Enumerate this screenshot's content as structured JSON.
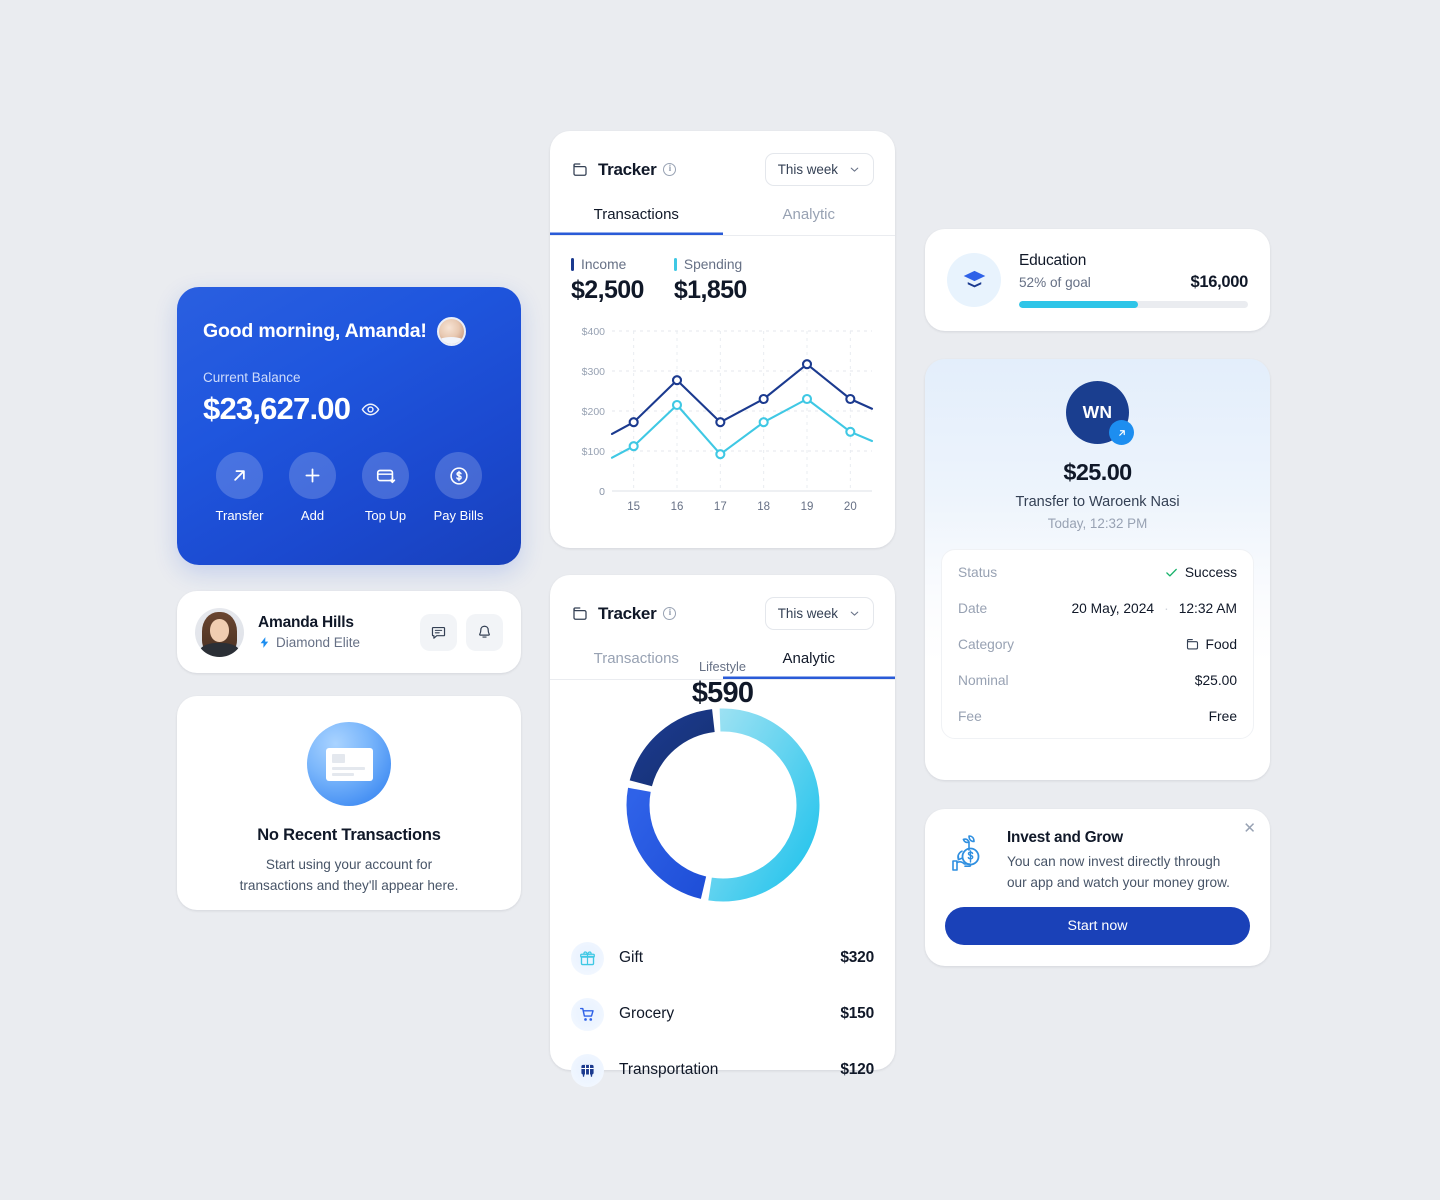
{
  "balance": {
    "greeting": "Good morning, Amanda!",
    "balance_label": "Current Balance",
    "balance_amount": "$23,627.00",
    "actions": [
      {
        "label": "Transfer",
        "icon": "arrow-up-right-icon"
      },
      {
        "label": "Add",
        "icon": "plus-icon"
      },
      {
        "label": "Top Up",
        "icon": "card-download-icon"
      },
      {
        "label": "Pay Bills",
        "icon": "dollar-circle-icon"
      }
    ],
    "accent": "#1a4fd6"
  },
  "profile": {
    "name": "Amanda Hills",
    "tier": "Diamond Elite",
    "tier_icon": "lightning-bolt-icon",
    "message_icon": "message-icon",
    "bell_icon": "bell-icon"
  },
  "empty_state": {
    "title": "No Recent Transactions",
    "line1": "Start using your account for",
    "line2": "transactions and they'll appear here."
  },
  "tracker_transactions": {
    "title": "Tracker",
    "range": "This week",
    "tabs": [
      {
        "label": "Transactions",
        "active": true
      },
      {
        "label": "Analytic",
        "active": false
      }
    ],
    "income_label": "Income",
    "income_value": "$2,500",
    "income_color": "#1b3a8f",
    "spending_label": "Spending",
    "spending_value": "$1,850",
    "spending_color": "#3fc8e4"
  },
  "tracker_analytic": {
    "title": "Tracker",
    "range": "This week",
    "tabs": [
      {
        "label": "Transactions",
        "active": false
      },
      {
        "label": "Analytic",
        "active": true
      }
    ],
    "center_label": "Lifestyle",
    "center_value": "$590",
    "legend": [
      {
        "name": "Gift",
        "amount": "$320",
        "icon": "gift-icon",
        "color": "#3fc8e4"
      },
      {
        "name": "Grocery",
        "amount": "$150",
        "icon": "shopping-cart-icon",
        "color": "#2f62e8"
      },
      {
        "name": "Transportation",
        "amount": "$120",
        "icon": "bus-icon",
        "color": "#1b3a8f"
      }
    ]
  },
  "chart_data": [
    {
      "type": "line",
      "title": "Tracker — Transactions",
      "x": [
        "15",
        "16",
        "17",
        "18",
        "19",
        "20"
      ],
      "xlabel": "",
      "ylabel": "",
      "ylim": [
        0,
        400
      ],
      "yticks": [
        "0",
        "$100",
        "$200",
        "$300",
        "$400"
      ],
      "grid": true,
      "legend": [
        "Income",
        "Spending"
      ],
      "series": [
        {
          "name": "Income",
          "color": "#1b3a8f",
          "values": [
            172,
            277,
            172,
            230,
            317,
            230
          ]
        },
        {
          "name": "Spending",
          "color": "#3fc8e4",
          "values": [
            112,
            215,
            92,
            172,
            230,
            148
          ]
        }
      ]
    },
    {
      "type": "pie",
      "title": "Lifestyle spending breakdown",
      "center_label": "Lifestyle",
      "center_value": 590,
      "categories": [
        "Gift",
        "Grocery",
        "Transportation"
      ],
      "values": [
        320,
        150,
        120
      ],
      "colors": [
        "#3fc8e4",
        "#2f62e8",
        "#1b3a8f"
      ],
      "legend": "below"
    }
  ],
  "goal": {
    "title": "Education",
    "subtitle": "52% of goal",
    "amount": "$16,000",
    "progress_percent": 52,
    "progress_color": "#2ec5e8",
    "icon": "graduation-cap-icon"
  },
  "transfer": {
    "initials": "WN",
    "amount": "$25.00",
    "description": "Transfer to Waroenk Nasi",
    "when": "Today, 12:32 PM",
    "badge_icon": "arrow-up-right-icon",
    "details": [
      {
        "key": "Status",
        "value": "Success",
        "icon": "check-icon",
        "icon_color": "#18b26b"
      },
      {
        "key": "Date",
        "value": "20 May, 2024",
        "value2": "12:32 AM",
        "separator": "·"
      },
      {
        "key": "Category",
        "value": "Food",
        "icon": "wallet-icon"
      },
      {
        "key": "Nominal",
        "value": "$25.00"
      },
      {
        "key": "Fee",
        "value": "Free"
      }
    ]
  },
  "promo": {
    "title": "Invest and Grow",
    "line1": "You can now invest directly through",
    "line2": "our app and watch your money grow.",
    "button": "Start now",
    "close_icon": "close-icon",
    "illustration": "money-plant-hand-icon"
  }
}
